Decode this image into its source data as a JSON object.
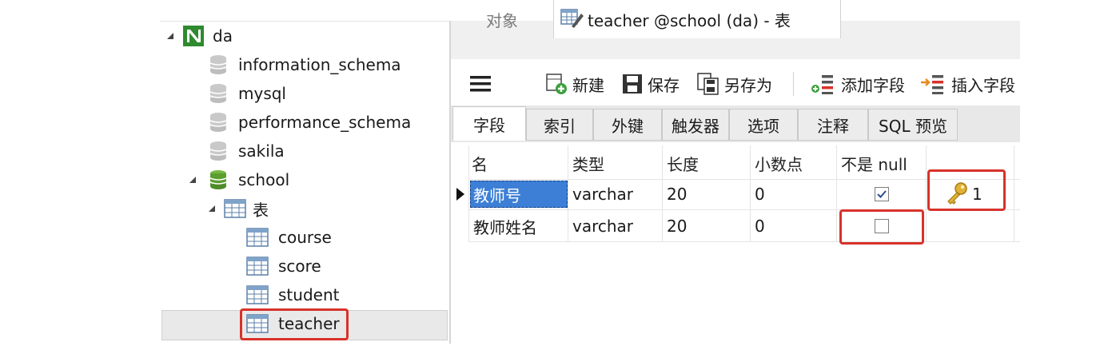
{
  "tree": {
    "connection": "da",
    "databases": [
      "information_schema",
      "mysql",
      "performance_schema",
      "sakila",
      "school"
    ],
    "tables_node": "表",
    "tables": [
      "course",
      "score",
      "student",
      "teacher"
    ]
  },
  "tabs": {
    "objects": "对象",
    "editor": "teacher @school (da) - 表"
  },
  "toolbar": {
    "new": "新建",
    "save": "保存",
    "save_as": "另存为",
    "add_field": "添加字段",
    "insert_field": "插入字段"
  },
  "subtabs": [
    "字段",
    "索引",
    "外键",
    "触发器",
    "选项",
    "注释",
    "SQL 预览"
  ],
  "grid": {
    "headers": [
      "名",
      "类型",
      "长度",
      "小数点",
      "不是 null"
    ],
    "rows": [
      {
        "name": "教师号",
        "type": "varchar",
        "length": "20",
        "decimals": "0",
        "not_null": true,
        "key": "1"
      },
      {
        "name": "教师姓名",
        "type": "varchar",
        "length": "20",
        "decimals": "0",
        "not_null": false,
        "key": ""
      }
    ]
  },
  "colors": {
    "highlight_red": "#d8322a",
    "selection_blue": "#3d7fd6",
    "db_green": "#5a9e2f",
    "key_gold": "#e0b23a"
  }
}
